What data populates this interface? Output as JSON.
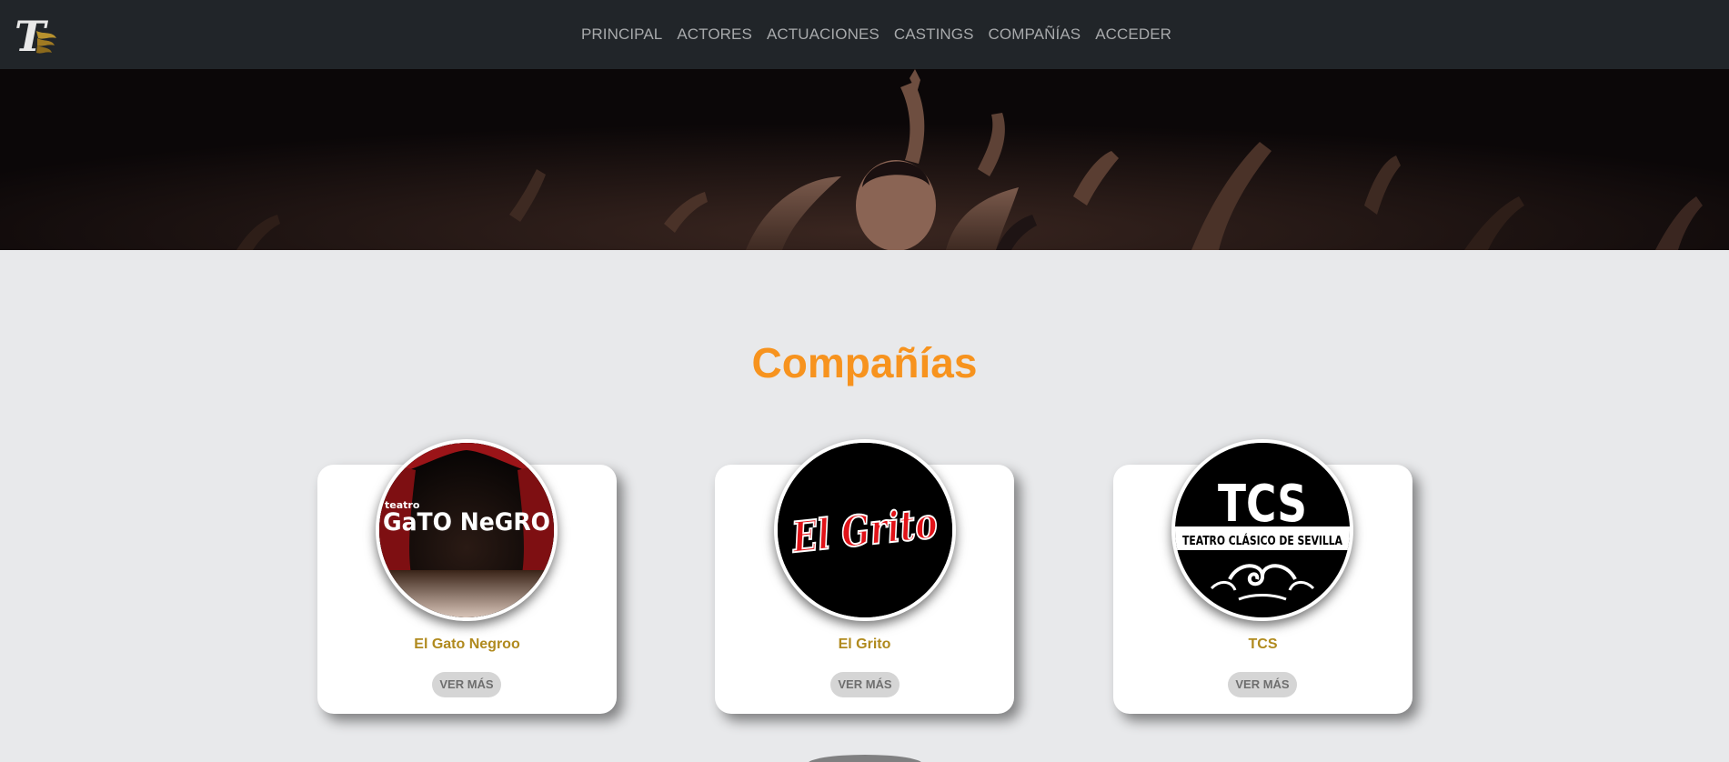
{
  "navbar": {
    "logo_letter": "T",
    "links": [
      "PRINCIPAL",
      "ACTORES",
      "ACTUACIONES",
      "CASTINGS",
      "COMPAÑÍAS",
      "ACCEDER"
    ]
  },
  "section": {
    "title": "Compañías"
  },
  "companies": [
    {
      "name": "El Gato Negroo",
      "button": "VER MÁS",
      "logo_text": [
        "teatro",
        "GaTO NeGRO"
      ]
    },
    {
      "name": "El Grito",
      "button": "VER MÁS",
      "logo_text": [
        "El Grito"
      ]
    },
    {
      "name": "TCS",
      "button": "VER MÁS",
      "logo_text": [
        "TCS",
        "TEATRO CLÁSICO DE SEVILLA"
      ]
    }
  ],
  "colors": {
    "navbar_bg": "#212529",
    "nav_link": "#a7a9ab",
    "page_bg": "#e8e9eb",
    "title": "#f7931e",
    "company_name": "#b08a1e",
    "button_bg": "#d5d5d5"
  }
}
